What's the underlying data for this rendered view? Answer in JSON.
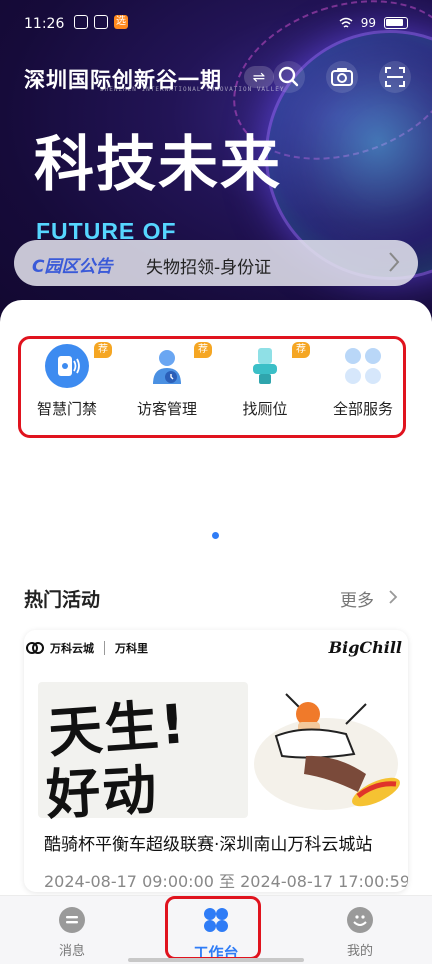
{
  "status_bar": {
    "time": "11:26",
    "badge": "选",
    "battery": "99"
  },
  "header": {
    "title": "深圳国际创新谷一期",
    "subtitle": "SHENZHEN INTERNATIONAL INNOVATION VALLEY",
    "swap_symbol": "⇌",
    "icons": [
      "search-icon",
      "camera-icon",
      "scan-icon"
    ]
  },
  "banner": {
    "headline": "科技未来",
    "tagline": "FUTURE OF"
  },
  "notice": {
    "tag": "C园区公告",
    "text": "失物招领-身份证"
  },
  "services": [
    {
      "label": "智慧门禁",
      "badge": "荐",
      "icon": "access-control-icon",
      "color": "#3d8bf0"
    },
    {
      "label": "访客管理",
      "badge": "荐",
      "icon": "visitor-icon",
      "color": "#4a90e2"
    },
    {
      "label": "找厕位",
      "badge": "荐",
      "icon": "toilet-icon",
      "color": "#3bbfc7"
    },
    {
      "label": "全部服务",
      "badge": "",
      "icon": "grid-icon",
      "color": "#b9d7f8"
    }
  ],
  "hot_events": {
    "title": "热门活动",
    "more": "更多",
    "card": {
      "brand_left_1": "万科云城",
      "brand_left_2": "万科里",
      "brand_right": "BigChill",
      "slogan_line1": "天生!",
      "slogan_line2": "好动",
      "title": "酷骑杯平衡车超级联赛·深圳南山万科云城站",
      "time": "2024-08-17 09:00:00 至 2024-08-17 17:00:59"
    }
  },
  "tabbar": {
    "tabs": [
      {
        "label": "消息",
        "icon": "message-icon",
        "active": false
      },
      {
        "label": "工作台",
        "icon": "workbench-icon",
        "active": true
      },
      {
        "label": "我的",
        "icon": "profile-icon",
        "active": false
      }
    ]
  },
  "colors": {
    "accent": "#2f7cf6",
    "highlight_border": "#e0131e",
    "badge": "#f5a623"
  }
}
